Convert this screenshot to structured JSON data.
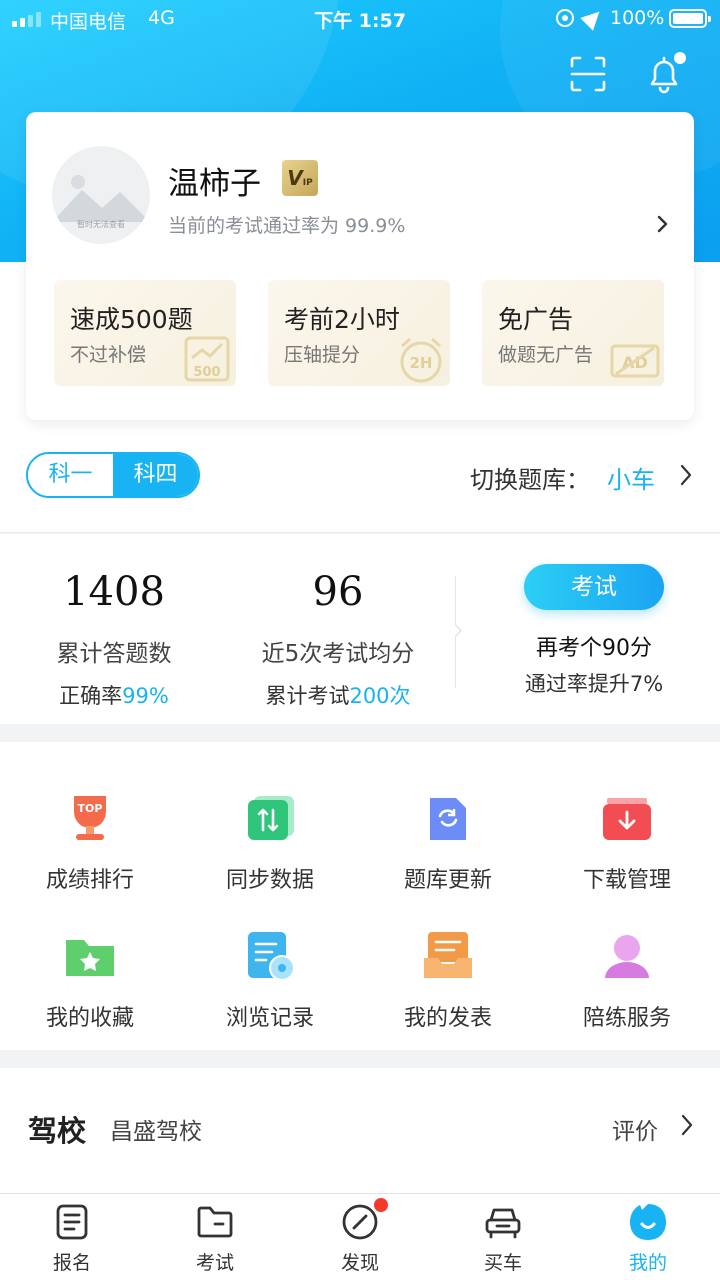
{
  "status_bar": {
    "carrier": "中国电信",
    "network": "4G",
    "time": "下午 1:57",
    "battery": "100%"
  },
  "header": {
    "icons": [
      "scan-icon",
      "bell-icon"
    ]
  },
  "profile": {
    "avatar_text": "暂时无法查看",
    "name": "温柿子",
    "vip_label": "V",
    "vip_small": "IP",
    "pass_rate_text": "当前的考试通过率为 99.9%",
    "perks": [
      {
        "title": "速成500题",
        "subtitle": "不过补偿",
        "art": "500"
      },
      {
        "title": "考前2小时",
        "subtitle": "压轴提分",
        "art": "2H"
      },
      {
        "title": "免广告",
        "subtitle": "做题无广告",
        "art": "AD"
      }
    ]
  },
  "subject_switch": {
    "options": [
      "科一",
      "科四"
    ],
    "selected": "科四",
    "bank_label": "切换题库：",
    "bank_value": "小车"
  },
  "stats": {
    "answered_count": "1408",
    "answered_label": "累计答题数",
    "accuracy_label": "正确率",
    "accuracy_value": "99%",
    "avg_score": "96",
    "avg_label": "近5次考试均分",
    "exams_label": "累计考试",
    "exams_value": "200次",
    "exam_button": "考试",
    "tip_line1": "再考个90分",
    "tip_line2": "通过率提升7%"
  },
  "grid": [
    {
      "label": "成绩排行",
      "icon": "trophy-icon",
      "color": "#f36b4b"
    },
    {
      "label": "同步数据",
      "icon": "sync-icon",
      "color": "#2fc57a"
    },
    {
      "label": "题库更新",
      "icon": "refresh-icon",
      "color": "#6b8df5"
    },
    {
      "label": "下载管理",
      "icon": "download-icon",
      "color": "#f24d53"
    },
    {
      "label": "我的收藏",
      "icon": "star-folder-icon",
      "color": "#5fcf6d"
    },
    {
      "label": "浏览记录",
      "icon": "history-icon",
      "color": "#3fb5f0"
    },
    {
      "label": "我的发表",
      "icon": "tray-icon",
      "color": "#f39a46"
    },
    {
      "label": "陪练服务",
      "icon": "person-icon",
      "color": "#d77be0"
    }
  ],
  "school": {
    "title": "驾校",
    "name": "昌盛驾校",
    "rate_label": "评价"
  },
  "tabbar": [
    {
      "label": "报名",
      "icon": "document-icon"
    },
    {
      "label": "考试",
      "icon": "folder-icon"
    },
    {
      "label": "发现",
      "icon": "compass-icon"
    },
    {
      "label": "买车",
      "icon": "car-icon"
    },
    {
      "label": "我的",
      "icon": "smile-icon"
    }
  ]
}
